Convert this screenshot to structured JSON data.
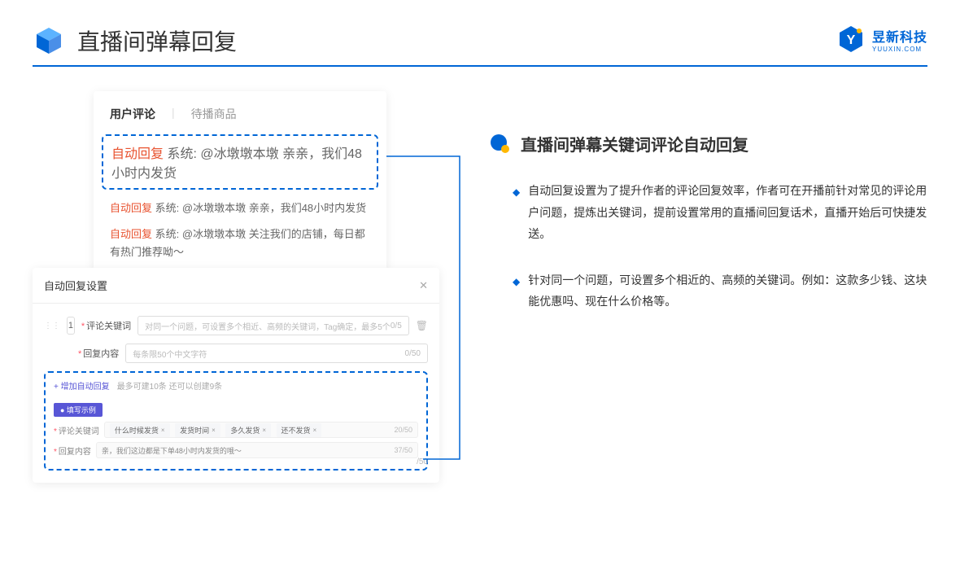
{
  "header": {
    "title": "直播间弹幕回复"
  },
  "logo": {
    "name": "昱新科技",
    "domain": "YUUXIN.COM"
  },
  "comments": {
    "tab_active": "用户评论",
    "tab_inactive": "待播商品",
    "tag": "自动回复",
    "sys": "系统:",
    "row1": "@冰墩墩本墩 亲亲，我们48小时内发货",
    "row2": "@冰墩墩本墩 亲亲，我们48小时内发货",
    "row3": "@冰墩墩本墩 关注我们的店铺，每日都有热门推荐呦～"
  },
  "settings": {
    "title": "自动回复设置",
    "idx": "1",
    "kw_label": "评论关键词",
    "kw_placeholder": "对同一个问题，可设置多个相近、高频的关键词，Tag确定，最多5个",
    "kw_counter": "0/5",
    "content_label": "回复内容",
    "content_placeholder": "每条限50个中文字符",
    "content_counter": "0/50",
    "add_link": "+ 增加自动回复",
    "hint": "最多可建10条 还可以创建9条",
    "example_tag": "● 填写示例",
    "ex_kw_label": "评论关键词",
    "chips": [
      "什么时候发货",
      "发货时间",
      "多久发货",
      "还不发货"
    ],
    "ex_kw_counter": "20/50",
    "ex_content_label": "回复内容",
    "ex_content_value": "亲，我们这边都是下单48小时内发货的哦～",
    "ex_content_counter": "37/50",
    "outer_counter": "/50"
  },
  "right": {
    "section_title": "直播间弹幕关键词评论自动回复",
    "bullet1": "自动回复设置为了提升作者的评论回复效率，作者可在开播前针对常见的评论用户问题，提炼出关键词，提前设置常用的直播间回复话术，直播开始后可快捷发送。",
    "bullet2": "针对同一个问题，可设置多个相近的、高频的关键词。例如：这款多少钱、这块能优惠吗、现在什么价格等。"
  }
}
